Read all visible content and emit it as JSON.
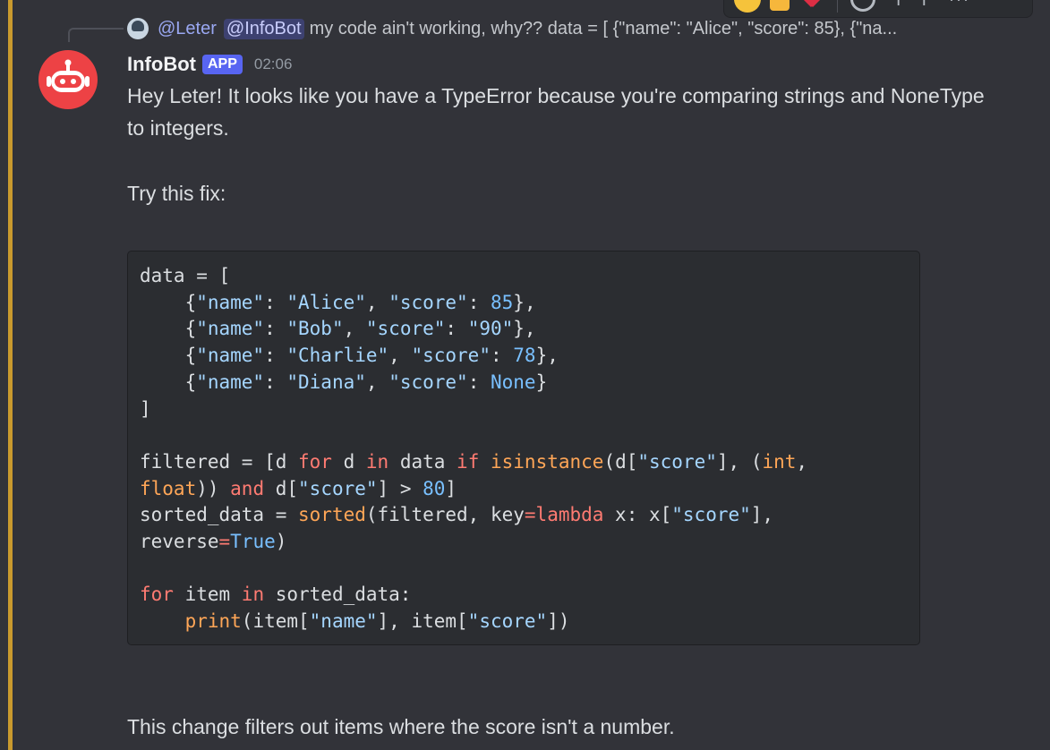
{
  "reply": {
    "author": "@Leter",
    "mention": "@InfoBot",
    "preview": "my code ain't working, why??  data = [     {\"name\": \"Alice\", \"score\": 85},     {\"na..."
  },
  "message": {
    "username": "InfoBot",
    "badge": "APP",
    "timestamp": "02:06",
    "para1": "Hey Leter! It looks like you have a TypeError because you're comparing strings and NoneType to integers.",
    "para2": "Try this fix:",
    "para3": "This change filters out items where the score isn't a number."
  },
  "code": {
    "l1_a": "data = [",
    "l2_s1": "\"name\"",
    "l2_s2": "\"Alice\"",
    "l2_s3": "\"score\"",
    "l2_n": "85",
    "l3_s1": "\"name\"",
    "l3_s2": "\"Bob\"",
    "l3_s3": "\"score\"",
    "l3_s4": "\"90\"",
    "l4_s1": "\"name\"",
    "l4_s2": "\"Charlie\"",
    "l4_s3": "\"score\"",
    "l4_n": "78",
    "l5_s1": "\"name\"",
    "l5_s2": "\"Diana\"",
    "l5_s3": "\"score\"",
    "l5_n": "None",
    "l6": "]",
    "l8_a": "filtered = [d ",
    "l8_k1": "for",
    "l8_b": " d ",
    "l8_k2": "in",
    "l8_c": " data ",
    "l8_k3": "if",
    "l8_d": " ",
    "l8_f": "isinstance",
    "l8_e": "(d[",
    "l8_s": "\"score\"",
    "l8_g": "], (",
    "l8_t1": "int",
    "l8_h": ",",
    "l9_t2": "float",
    "l9_a": ")) ",
    "l9_k": "and",
    "l9_b": " d[",
    "l9_s": "\"score\"",
    "l9_c": "] > ",
    "l9_n": "80",
    "l9_d": "]",
    "l10_a": "sorted_data = ",
    "l10_f": "sorted",
    "l10_b": "(filtered, key",
    "l10_eq": "=",
    "l10_k": "lambda",
    "l10_c": " x: x[",
    "l10_s": "\"score\"",
    "l10_d": "],",
    "l11_a": "reverse",
    "l11_eq": "=",
    "l11_n": "True",
    "l11_b": ")",
    "l13_k1": "for",
    "l13_a": " item ",
    "l13_k2": "in",
    "l13_b": " sorted_data:",
    "l14_f": "print",
    "l14_a": "(item[",
    "l14_s1": "\"name\"",
    "l14_b": "], item[",
    "l14_s2": "\"score\"",
    "l14_c": "])"
  },
  "actions": {
    "more": "···"
  }
}
